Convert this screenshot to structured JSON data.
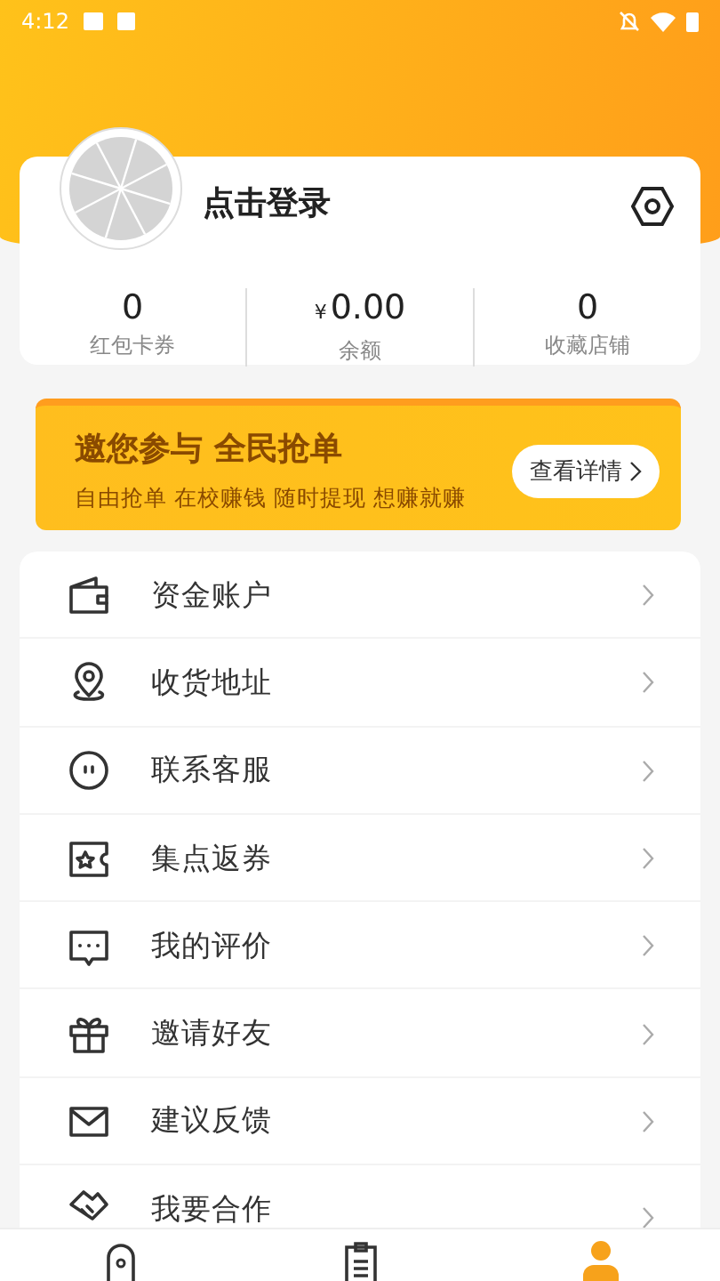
{
  "status_bar": {
    "time": "4:12"
  },
  "profile": {
    "login_text": "点击登录",
    "stats": [
      {
        "value": "0",
        "label": "红包卡券",
        "kind": "count"
      },
      {
        "currency": "¥",
        "value": "0.00",
        "label": "余额",
        "kind": "money"
      },
      {
        "value": "0",
        "label": "收藏店铺",
        "kind": "count"
      }
    ]
  },
  "banner": {
    "title": "邀您参与 全民抢单",
    "subtitle": "自由抢单 在校赚钱 随时提现 想赚就赚",
    "button": "查看详情"
  },
  "menu": [
    {
      "label": "资金账户",
      "kind": "wallet"
    },
    {
      "label": "收货地址",
      "kind": "location"
    },
    {
      "label": "联系客服",
      "kind": "service"
    },
    {
      "label": "集点返券",
      "kind": "coupon"
    },
    {
      "label": "我的评价",
      "kind": "comment"
    },
    {
      "label": "邀请好友",
      "kind": "gift"
    },
    {
      "label": "建议反馈",
      "kind": "mail"
    },
    {
      "label": "我要合作",
      "kind": "handshake"
    }
  ],
  "bottom_nav": [
    {
      "kind": "home",
      "selected": false
    },
    {
      "kind": "orders",
      "selected": false
    },
    {
      "kind": "profile",
      "selected": true
    }
  ]
}
